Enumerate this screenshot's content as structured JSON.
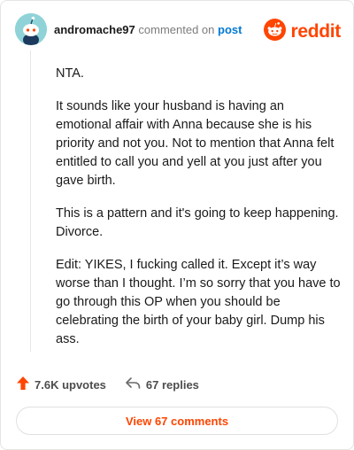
{
  "comment": {
    "username": "andromache97",
    "commented_text": "commented on",
    "post_link": "post",
    "paragraphs": [
      "NTA.",
      "It sounds like your husband is having an emotional affair with Anna because she is his priority and not you. Not to mention that Anna felt entitled to call you and yell at you just after you gave birth.",
      "This is a pattern and it's going to keep happening. Divorce.",
      "Edit: YIKES, I fucking called it. Except it’s way worse than I thought. I’m so sorry that you have to go through this OP when you should be celebrating the birth of your baby girl. Dump his ass."
    ],
    "upvotes": "7.6K upvotes",
    "replies": "67 replies",
    "view_comments": "View 67 comments"
  },
  "brand": {
    "name": "reddit",
    "color": "#ff4500"
  },
  "icons": {
    "avatar": "snoo-avatar-icon",
    "logo": "reddit-logo-icon",
    "upvote": "upvote-arrow-icon",
    "reply": "reply-arrow-icon"
  }
}
